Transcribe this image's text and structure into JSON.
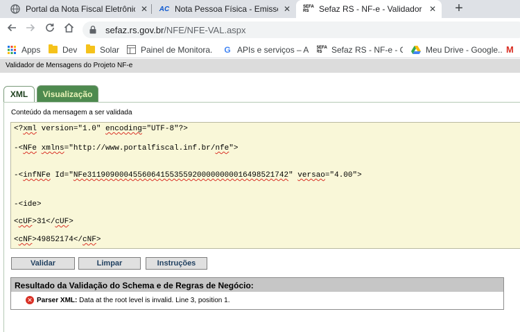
{
  "browser": {
    "tabs": [
      {
        "title": "Portal da Nota Fiscal Eletrônica",
        "icon": "globe-icon",
        "active": false
      },
      {
        "title": "Nota Pessoa Física - Emissor não",
        "icon": "ac-logo-icon",
        "active": false
      },
      {
        "title": "Sefaz RS - NF-e - Validador de M",
        "icon": "sefaz-rs-icon",
        "active": true
      }
    ],
    "favicon_texts": {
      "ac": "AC",
      "sefaz_top": "SEFA",
      "sefaz_bottom": "RS"
    },
    "close_glyph": "✕",
    "new_tab_glyph": "+",
    "url_host": "sefaz.rs.gov.br",
    "url_path": "/NFE/NFE-VAL.aspx",
    "bookmarks": [
      {
        "label": "Apps",
        "icon": "apps-grid-icon"
      },
      {
        "label": "Dev",
        "icon": "folder-icon"
      },
      {
        "label": "Solar",
        "icon": "folder-icon"
      },
      {
        "label": "Painel de Monitora...",
        "icon": "page-icon"
      },
      {
        "label": "APIs e serviços – AP...",
        "icon": "google-g-icon"
      },
      {
        "label": "Sefaz RS - NF-e - C...",
        "icon": "sefaz-rs-icon"
      },
      {
        "label": "Meu Drive - Google...",
        "icon": "google-drive-icon"
      },
      {
        "label": "M",
        "icon": "gmail-icon"
      }
    ],
    "colors": {
      "tabstrip": "#dee1e6",
      "omnibox": "#f1f3f4"
    }
  },
  "page": {
    "header": "Validador de Mensagens do Projeto NF-e",
    "tabs": [
      {
        "label": "XML",
        "active": true
      },
      {
        "label": "Visualização",
        "active": false
      }
    ],
    "content_label": "Conteúdo da mensagem a ser validada",
    "xml_lines": [
      [
        "<?",
        {
          "sq": "xml"
        },
        " version=\"1.0\" ",
        {
          "sq": "encoding"
        },
        "=\"UTF-8\"?>"
      ],
      [
        "-<",
        {
          "sq": "NFe"
        },
        " ",
        {
          "sq": "xmlns"
        },
        "=\"http://www.portalfiscal.inf.br/",
        {
          "sq": "nfe"
        },
        "\">"
      ],
      [
        "-<",
        {
          "sq": "infNFe"
        },
        " Id=\"",
        {
          "sq": "NFe31190900045560641553559200000000016498521742"
        },
        "\" ",
        {
          "sq": "versao"
        },
        "=\"4.00\">"
      ],
      [
        "-<ide>"
      ],
      [
        "<",
        {
          "sq": "cUF"
        },
        ">31</",
        {
          "sq": "cUF"
        },
        ">"
      ],
      [
        "<",
        {
          "sq": "cNF"
        },
        ">49852174</",
        {
          "sq": "cNF"
        },
        ">"
      ]
    ],
    "buttons": {
      "validar": "Validar",
      "limpar": "Limpar",
      "instrucoes": "Instruções"
    },
    "result": {
      "title": "Resultado da Validação do Schema e de Regras de Negócio:",
      "error_label": "Parser XML:",
      "error_text": " Data at the root level is invalid. Line 3, position 1."
    },
    "colors": {
      "tab_active_green": "#4e8a4f",
      "xml_bg": "#f9f7d8",
      "error_red": "#d93025"
    }
  }
}
